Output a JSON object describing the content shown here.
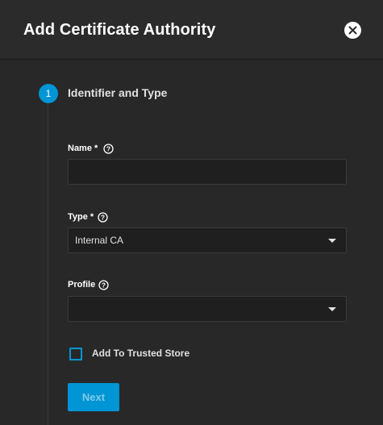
{
  "dialog": {
    "title": "Add Certificate Authority"
  },
  "stepper": {
    "step_number": "1",
    "step_label": "Identifier and Type"
  },
  "form": {
    "name": {
      "label": "Name",
      "required_mark": "*",
      "value": ""
    },
    "type": {
      "label": "Type",
      "required_mark": "*",
      "value": "Internal CA"
    },
    "profile": {
      "label": "Profile",
      "value": ""
    },
    "trusted_store": {
      "label": "Add To Trusted Store",
      "checked": false
    }
  },
  "actions": {
    "next_label": "Next"
  },
  "icons": {
    "close": "close-icon",
    "help": "help-circle-icon",
    "dropdown": "chevron-down-icon"
  },
  "colors": {
    "accent": "#0095d5",
    "background": "#282828",
    "input_background": "#1f1f1f"
  }
}
